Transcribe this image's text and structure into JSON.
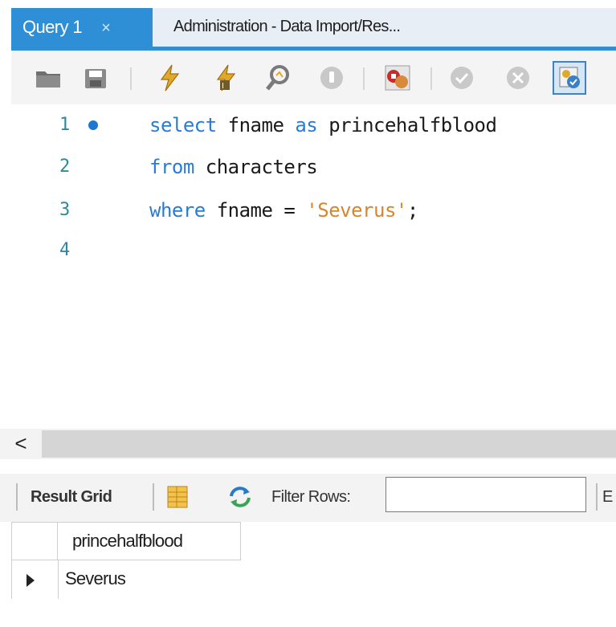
{
  "tabs": [
    {
      "label": "Query 1",
      "active": true,
      "close": "×"
    },
    {
      "label": "Administration - Data Import/Res...",
      "active": false
    }
  ],
  "toolbar": {
    "icons": [
      "open-folder-icon",
      "save-icon",
      "execute-icon",
      "execute-current-icon",
      "explain-icon",
      "stop-icon",
      "toggle-error-stop-icon",
      "commit-icon",
      "rollback-icon",
      "autocommit-icon"
    ]
  },
  "editor": {
    "lines": [
      {
        "number": "1",
        "has_marker": true
      },
      {
        "number": "2"
      },
      {
        "number": "3"
      },
      {
        "number": "4"
      }
    ],
    "code": {
      "l1_kw1": "select",
      "l1_id1": " fname ",
      "l1_kw2": "as",
      "l1_id2": " princehalfblood",
      "l2_kw1": "from",
      "l2_id1": " characters",
      "l3_kw1": "where",
      "l3_id1": " fname = ",
      "l3_str": "'Severus'",
      "l3_end": ";"
    },
    "colors": {
      "keyword": "#2a7bd6",
      "string": "#d9862a",
      "line_number": "#2d8a9a"
    }
  },
  "scrollbar": {
    "left_arrow": "<"
  },
  "results": {
    "tab_label": "Result Grid",
    "filter_label": "Filter Rows:",
    "filter_value": "",
    "truncated_next": "E",
    "columns": [
      "princehalfblood"
    ],
    "rows": [
      [
        "Severus"
      ]
    ]
  },
  "colors": {
    "accent": "#2f8fd6"
  }
}
